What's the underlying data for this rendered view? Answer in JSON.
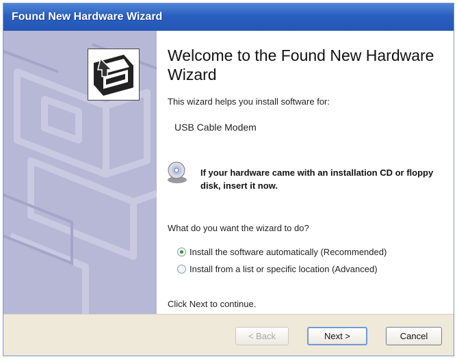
{
  "window": {
    "title": "Found New Hardware Wizard"
  },
  "wizard": {
    "heading": "Welcome to the Found New Hardware Wizard",
    "intro": "This wizard helps you install software for:",
    "device_name": "USB Cable Modem",
    "cd_prompt": "If your hardware came with an installation CD or floppy disk, insert it now.",
    "question": "What do you want the wizard to do?",
    "options": [
      {
        "label": "Install the software automatically (Recommended)",
        "selected": true
      },
      {
        "label": "Install from a list or specific location (Advanced)",
        "selected": false
      }
    ],
    "continue_text": "Click Next to continue."
  },
  "buttons": {
    "back": "< Back",
    "next": "Next >",
    "cancel": "Cancel"
  },
  "icons": {
    "hardware": "hardware-icon",
    "cd": "cd-icon"
  },
  "colors": {
    "titlebar": "#2a5fbf",
    "left_panel": "#b7b7d6",
    "button_bar": "#efe9d9"
  }
}
